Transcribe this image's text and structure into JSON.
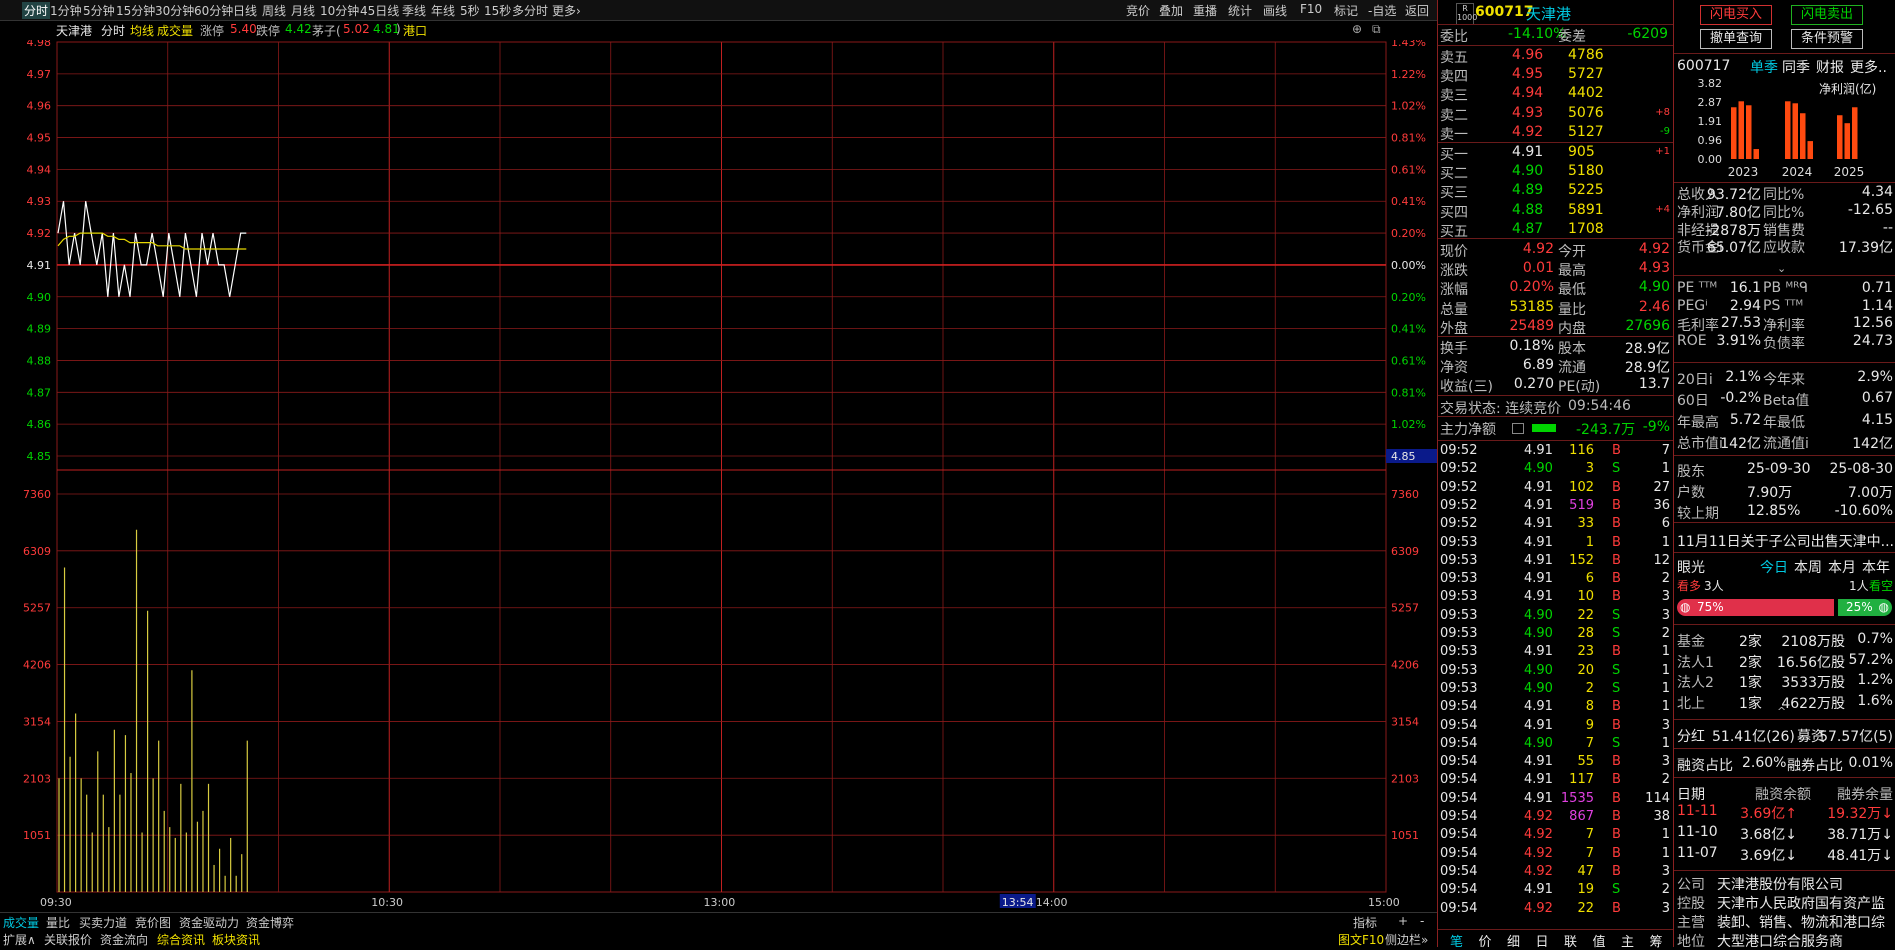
{
  "toolbar": {
    "periods": [
      "分时",
      "1分钟",
      "5分钟",
      "15分钟",
      "30分钟",
      "60分钟",
      "日线",
      "周线",
      "月线",
      "10分钟",
      "45日线",
      "季线",
      "年线",
      "5秒",
      "15秒",
      "多分时",
      "更多"
    ],
    "right": [
      "竞价",
      "叠加",
      "重播",
      "统计",
      "画线",
      "F10",
      "标记",
      "-自选",
      "返回"
    ]
  },
  "info": {
    "name": "天津港",
    "mode": "分时",
    "avg_label": "均线",
    "vol_label": "成交量",
    "limit_up_label": "涨停",
    "limit_up": "5.40",
    "limit_down_label": "跌停",
    "limit_down": "4.42",
    "mao_label": "茅子(",
    "mao_a": "5.02",
    "mao_b": "4.81",
    "mao_close": ")",
    "sector": "港口"
  },
  "chart_data": {
    "type": "line",
    "price_axis": [
      "4.98",
      "4.97",
      "4.96",
      "4.95",
      "4.94",
      "4.93",
      "4.92",
      "4.91",
      "4.90",
      "4.89",
      "4.88",
      "4.87",
      "4.86",
      "4.85"
    ],
    "pct_axis": [
      "1.43%",
      "1.22%",
      "1.02%",
      "0.81%",
      "0.61%",
      "0.41%",
      "0.20%",
      "0.00%",
      "0.20%",
      "0.41%",
      "0.61%",
      "0.81%",
      "1.02%",
      ""
    ],
    "vol_axis": [
      "7360",
      "6309",
      "5257",
      "4206",
      "3154",
      "2103",
      "1051"
    ],
    "time_labels": [
      "09:30",
      "10:30",
      "13:00",
      "14:00",
      "15:00"
    ],
    "cursor_time": "13:54",
    "cursor_price": "4.85",
    "ylim": [
      4.85,
      4.98
    ],
    "prev_close": 4.91,
    "price": [
      4.92,
      4.93,
      4.91,
      4.92,
      4.91,
      4.93,
      4.92,
      4.91,
      4.92,
      4.9,
      4.92,
      4.9,
      4.91,
      4.9,
      4.92,
      4.91,
      4.91,
      4.92,
      4.91,
      4.9,
      4.92,
      4.91,
      4.9,
      4.92,
      4.91,
      4.9,
      4.92,
      4.91,
      4.92,
      4.91,
      4.91,
      4.9,
      4.91,
      4.92,
      4.92
    ],
    "avg": [
      4.916,
      4.918,
      4.919,
      4.919,
      4.92,
      4.92,
      4.92,
      4.92,
      4.92,
      4.919,
      4.919,
      4.918,
      4.918,
      4.917,
      4.917,
      4.917,
      4.917,
      4.917,
      4.916,
      4.916,
      4.916,
      4.916,
      4.916,
      4.915,
      4.915,
      4.915,
      4.915,
      4.915,
      4.915,
      4.915,
      4.915,
      4.915,
      4.915,
      4.915,
      4.915
    ],
    "volume": [
      2100,
      6000,
      2500,
      3300,
      2100,
      1800,
      1100,
      2600,
      1800,
      1200,
      3000,
      1800,
      2900,
      2200,
      6700,
      1100,
      5200,
      2100,
      2800,
      1500,
      1200,
      1000,
      2000,
      1100,
      4100,
      1300,
      1500,
      2000,
      500,
      800,
      300,
      1000,
      300,
      700,
      2800
    ],
    "vol_max": 7360,
    "vol_color": "#d8cc40",
    "price_color": "#ffffff",
    "avg_color": "#e6d800"
  },
  "bottom_tabs": [
    "成交量",
    "量比",
    "买卖力道",
    "竞价图",
    "资金驱动力",
    "资金博弈"
  ],
  "bottom_right": [
    "指标",
    "+",
    "-"
  ],
  "bottom2_tabs": [
    "扩展∧",
    "关联报价",
    "资金流向",
    "综合资讯",
    "板块资讯"
  ],
  "bottom2_right": [
    "图文F10",
    "侧边栏»"
  ],
  "quote": {
    "badge_top": "R",
    "badge_bot": "1000",
    "code": "600717",
    "name": "天津港",
    "weibi_label": "委比",
    "weibi": "-14.10%",
    "weicha_label": "委差",
    "weicha": "-6209",
    "asks": [
      {
        "label": "卖五",
        "price": "4.96",
        "vol": "4786",
        "chg": ""
      },
      {
        "label": "卖四",
        "price": "4.95",
        "vol": "5727",
        "chg": ""
      },
      {
        "label": "卖三",
        "price": "4.94",
        "vol": "4402",
        "chg": ""
      },
      {
        "label": "卖二",
        "price": "4.93",
        "vol": "5076",
        "chg": "+8"
      },
      {
        "label": "卖一",
        "price": "4.92",
        "vol": "5127",
        "chg": "-9"
      }
    ],
    "bids": [
      {
        "label": "买一",
        "price": "4.91",
        "vol": "905",
        "chg": "+1"
      },
      {
        "label": "买二",
        "price": "4.90",
        "vol": "5180",
        "chg": ""
      },
      {
        "label": "买三",
        "price": "4.89",
        "vol": "5225",
        "chg": ""
      },
      {
        "label": "买四",
        "price": "4.88",
        "vol": "5891",
        "chg": "+4"
      },
      {
        "label": "买五",
        "price": "4.87",
        "vol": "1708",
        "chg": ""
      }
    ],
    "stats": [
      {
        "l1": "现价",
        "v1": "4.92",
        "c1": "red",
        "l2": "今开",
        "v2": "4.92",
        "c2": "red"
      },
      {
        "l1": "涨跌",
        "v1": "0.01",
        "c1": "red",
        "l2": "最高",
        "v2": "4.93",
        "c2": "red"
      },
      {
        "l1": "涨幅",
        "v1": "0.20%",
        "c1": "red",
        "l2": "最低",
        "v2": "4.90",
        "c2": "grn"
      },
      {
        "l1": "总量",
        "v1": "53185",
        "c1": "yel",
        "l2": "量比",
        "v2": "2.46",
        "c2": "red"
      },
      {
        "l1": "外盘",
        "v1": "25489",
        "c1": "red",
        "l2": "内盘",
        "v2": "27696",
        "c2": "grn"
      }
    ],
    "stats2": [
      {
        "l1": "换手",
        "v1": "0.18%",
        "l2": "股本",
        "v2": "28.9亿"
      },
      {
        "l1": "净资",
        "v1": "6.89",
        "l2": "流通",
        "v2": "28.9亿"
      },
      {
        "l1": "收益(三)",
        "v1": "0.270",
        "l2": "PE(动)",
        "v2": "13.7"
      }
    ],
    "status_label": "交易状态: 连续竞价",
    "status_time": "09:54:46",
    "main_flow_label": "主力净额",
    "main_flow": "-243.7万",
    "main_flow_pct": "-9%"
  },
  "ticks": [
    {
      "t": "09:52",
      "p": "4.91",
      "pc": "wht",
      "v": "116",
      "vc": "yel",
      "d": "B",
      "n": "7"
    },
    {
      "t": "09:52",
      "p": "4.90",
      "pc": "grn",
      "v": "3",
      "vc": "yel",
      "d": "S",
      "n": "1"
    },
    {
      "t": "09:52",
      "p": "4.91",
      "pc": "wht",
      "v": "102",
      "vc": "yel",
      "d": "B",
      "n": "27"
    },
    {
      "t": "09:52",
      "p": "4.91",
      "pc": "wht",
      "v": "519",
      "vc": "mag",
      "d": "B",
      "n": "36"
    },
    {
      "t": "09:52",
      "p": "4.91",
      "pc": "wht",
      "v": "33",
      "vc": "yel",
      "d": "B",
      "n": "6"
    },
    {
      "t": "09:53",
      "p": "4.91",
      "pc": "wht",
      "v": "1",
      "vc": "yel",
      "d": "B",
      "n": "1"
    },
    {
      "t": "09:53",
      "p": "4.91",
      "pc": "wht",
      "v": "152",
      "vc": "yel",
      "d": "B",
      "n": "12"
    },
    {
      "t": "09:53",
      "p": "4.91",
      "pc": "wht",
      "v": "6",
      "vc": "yel",
      "d": "B",
      "n": "2"
    },
    {
      "t": "09:53",
      "p": "4.91",
      "pc": "wht",
      "v": "10",
      "vc": "yel",
      "d": "B",
      "n": "3"
    },
    {
      "t": "09:53",
      "p": "4.90",
      "pc": "grn",
      "v": "22",
      "vc": "yel",
      "d": "S",
      "n": "3"
    },
    {
      "t": "09:53",
      "p": "4.90",
      "pc": "grn",
      "v": "28",
      "vc": "yel",
      "d": "S",
      "n": "2"
    },
    {
      "t": "09:53",
      "p": "4.91",
      "pc": "wht",
      "v": "23",
      "vc": "yel",
      "d": "B",
      "n": "1"
    },
    {
      "t": "09:53",
      "p": "4.90",
      "pc": "grn",
      "v": "20",
      "vc": "yel",
      "d": "S",
      "n": "1"
    },
    {
      "t": "09:53",
      "p": "4.90",
      "pc": "grn",
      "v": "2",
      "vc": "yel",
      "d": "S",
      "n": "1"
    },
    {
      "t": "09:54",
      "p": "4.91",
      "pc": "wht",
      "v": "8",
      "vc": "yel",
      "d": "B",
      "n": "1"
    },
    {
      "t": "09:54",
      "p": "4.91",
      "pc": "wht",
      "v": "9",
      "vc": "yel",
      "d": "B",
      "n": "3"
    },
    {
      "t": "09:54",
      "p": "4.90",
      "pc": "grn",
      "v": "7",
      "vc": "yel",
      "d": "S",
      "n": "1"
    },
    {
      "t": "09:54",
      "p": "4.91",
      "pc": "wht",
      "v": "55",
      "vc": "yel",
      "d": "B",
      "n": "3"
    },
    {
      "t": "09:54",
      "p": "4.91",
      "pc": "wht",
      "v": "117",
      "vc": "yel",
      "d": "B",
      "n": "2"
    },
    {
      "t": "09:54",
      "p": "4.91",
      "pc": "wht",
      "v": "1535",
      "vc": "mag",
      "d": "B",
      "n": "114"
    },
    {
      "t": "09:54",
      "p": "4.92",
      "pc": "red",
      "v": "867",
      "vc": "mag",
      "d": "B",
      "n": "38"
    },
    {
      "t": "09:54",
      "p": "4.92",
      "pc": "red",
      "v": "7",
      "vc": "yel",
      "d": "B",
      "n": "1"
    },
    {
      "t": "09:54",
      "p": "4.92",
      "pc": "red",
      "v": "7",
      "vc": "yel",
      "d": "B",
      "n": "1"
    },
    {
      "t": "09:54",
      "p": "4.92",
      "pc": "red",
      "v": "47",
      "vc": "yel",
      "d": "B",
      "n": "3"
    },
    {
      "t": "09:54",
      "p": "4.91",
      "pc": "wht",
      "v": "19",
      "vc": "yel",
      "d": "S",
      "n": "2"
    },
    {
      "t": "09:54",
      "p": "4.92",
      "pc": "red",
      "v": "22",
      "vc": "yel",
      "d": "B",
      "n": "3"
    }
  ],
  "ticks_tabs": [
    "笔",
    "价",
    "细",
    "日",
    "联",
    "值",
    "主",
    "筹"
  ],
  "side": {
    "btn_buy": "闪电买入",
    "btn_sell": "闪电卖出",
    "btn_order": "撤单查询",
    "btn_alert": "条件预警",
    "code": "600717",
    "tabs": [
      "单季",
      "同季",
      "财报",
      "更多.."
    ],
    "profit_label": "净利润(亿)",
    "y_ticks": [
      "3.82",
      "2.87",
      "1.91",
      "0.96",
      "0.00"
    ],
    "years": [
      "2023",
      "2024",
      "2025"
    ],
    "profit_bars": [
      [
        2.6,
        2.9,
        2.7,
        0.5
      ],
      [
        2.9,
        2.8,
        2.3,
        0.9
      ],
      [
        2.2,
        1.8,
        2.6
      ]
    ],
    "fin": [
      {
        "l1": "总收入",
        "v1": "93.72亿",
        "l2": "同比%",
        "v2": "4.34"
      },
      {
        "l1": "净利润",
        "v1": "7.80亿",
        "l2": "同比%",
        "v2": "-12.65"
      },
      {
        "l1": "非经损",
        "v1": "-2878万",
        "l2": "销售费",
        "v2": "--"
      },
      {
        "l1": "货币金i",
        "v1": "65.07亿",
        "l2": "应收款",
        "v2": "17.39亿"
      }
    ],
    "val": [
      {
        "l1": "PE ᵀᵀᴹ",
        "v1": "16.1",
        "l2": "PB ᴹᴿᑫ",
        "v2": "0.71"
      },
      {
        "l1": "PEGⁱ",
        "v1": "2.94",
        "l2": "PS ᵀᵀᴹ",
        "v2": "1.14"
      },
      {
        "l1": "毛利率",
        "v1": "27.53",
        "l2": "净利率",
        "v2": "12.56"
      },
      {
        "l1": "ROE",
        "v1": "3.91%",
        "l2": "负债率",
        "v2": "24.73"
      }
    ],
    "perf": [
      {
        "l1": "20日i",
        "v1": "2.1%",
        "l2": "今年来",
        "v2": "2.9%"
      },
      {
        "l1": "60日",
        "v1": "-0.2%",
        "l2": "Beta值",
        "v2": "0.67"
      },
      {
        "l1": "年最高",
        "v1": "5.72",
        "l2": "年最低",
        "v2": "4.15"
      },
      {
        "l1": "总市值i",
        "v1": "142亿",
        "l2": "流通值i",
        "v2": "142亿"
      }
    ],
    "holders": [
      {
        "l1": "股东",
        "v1": "25-09-30",
        "v2": "25-08-30"
      },
      {
        "l1": "户数",
        "v1": "7.90万",
        "v2": "7.00万"
      },
      {
        "l1": "较上期",
        "v1": "12.85%",
        "v2": "-10.60%"
      }
    ],
    "news": "11月11日关于子公司出售天津中...",
    "eye_label": "眼光",
    "eye_tabs": [
      "今日",
      "本周",
      "本月",
      "本年"
    ],
    "bull_label": "看多",
    "bull_count": "3人",
    "bear_count": "1人",
    "bear_label": "看空",
    "bull_pct": "75%",
    "bear_pct": "25%",
    "inst": [
      {
        "l": "基金",
        "n": "2家",
        "v": "2108万股",
        "p": "0.7%"
      },
      {
        "l": "法人1",
        "n": "2家",
        "v": "16.56亿股",
        "p": "57.2%"
      },
      {
        "l": "法人2",
        "n": "1家",
        "v": "3533万股",
        "p": "1.2%"
      },
      {
        "l": "北上",
        "n": "1家",
        "v": "4622万股",
        "p": "1.6%"
      }
    ],
    "dividend_label": "分红",
    "dividend": "51.41亿(26)",
    "raise_label": "募资",
    "raise": "57.57亿(5)",
    "margin_label": "融资占比",
    "margin": "2.60%",
    "short_label": "融券占比",
    "short": "0.01%",
    "mt_head": [
      "日期",
      "融资余额",
      "融券余量"
    ],
    "mt_rows": [
      {
        "d": "11-11",
        "a": "3.69亿↑",
        "b": "19.32万↓",
        "hl": true
      },
      {
        "d": "11-10",
        "a": "3.68亿↓",
        "b": "38.71万↓",
        "hl": false
      },
      {
        "d": "11-07",
        "a": "3.69亿↓",
        "b": "48.41万↓",
        "hl": false
      }
    ],
    "company_label": "公司",
    "company": "天津港股份有限公司",
    "ctrl_label": "控股",
    "ctrl": "天津市人民政府国有资产监",
    "biz_label": "主营",
    "biz": "装卸、销售、物流和港口综",
    "pos_label": "地位",
    "pos": "大型港口综合服务商"
  }
}
